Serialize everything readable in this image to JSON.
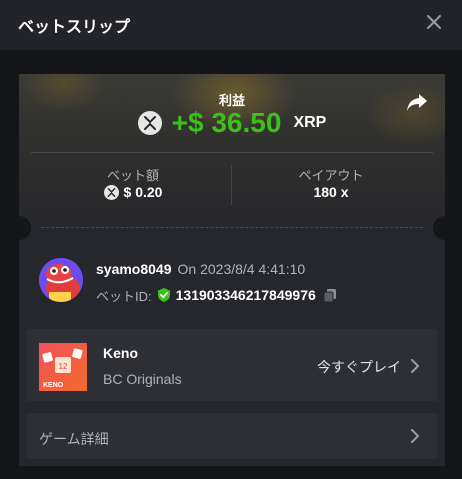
{
  "header": {
    "title": "ベットスリップ"
  },
  "summary": {
    "profit_label": "利益",
    "profit_amount": "+$ 36.50",
    "currency": "XRP",
    "bet_amount_label": "ベット額",
    "bet_amount": "$ 0.20",
    "payout_label": "ペイアウト",
    "payout": "180 x"
  },
  "player": {
    "username": "syamo8049",
    "date": "On 2023/8/4 4:41:10",
    "bet_id_label": "ベットID:",
    "bet_id": "131903346217849976"
  },
  "game": {
    "name": "Keno",
    "provider": "BC Originals",
    "thumb_label": "KENO",
    "thumb_number": "12",
    "play_label": "今すぐプレイ"
  },
  "details": {
    "label": "ゲーム詳細"
  },
  "colors": {
    "accent_green": "#3bc117",
    "background": "#141518",
    "card": "#26272c"
  },
  "icons": [
    "close-icon",
    "share-icon",
    "xrp-coin-icon",
    "shield-check-icon",
    "copy-icon",
    "chevron-right-icon"
  ]
}
